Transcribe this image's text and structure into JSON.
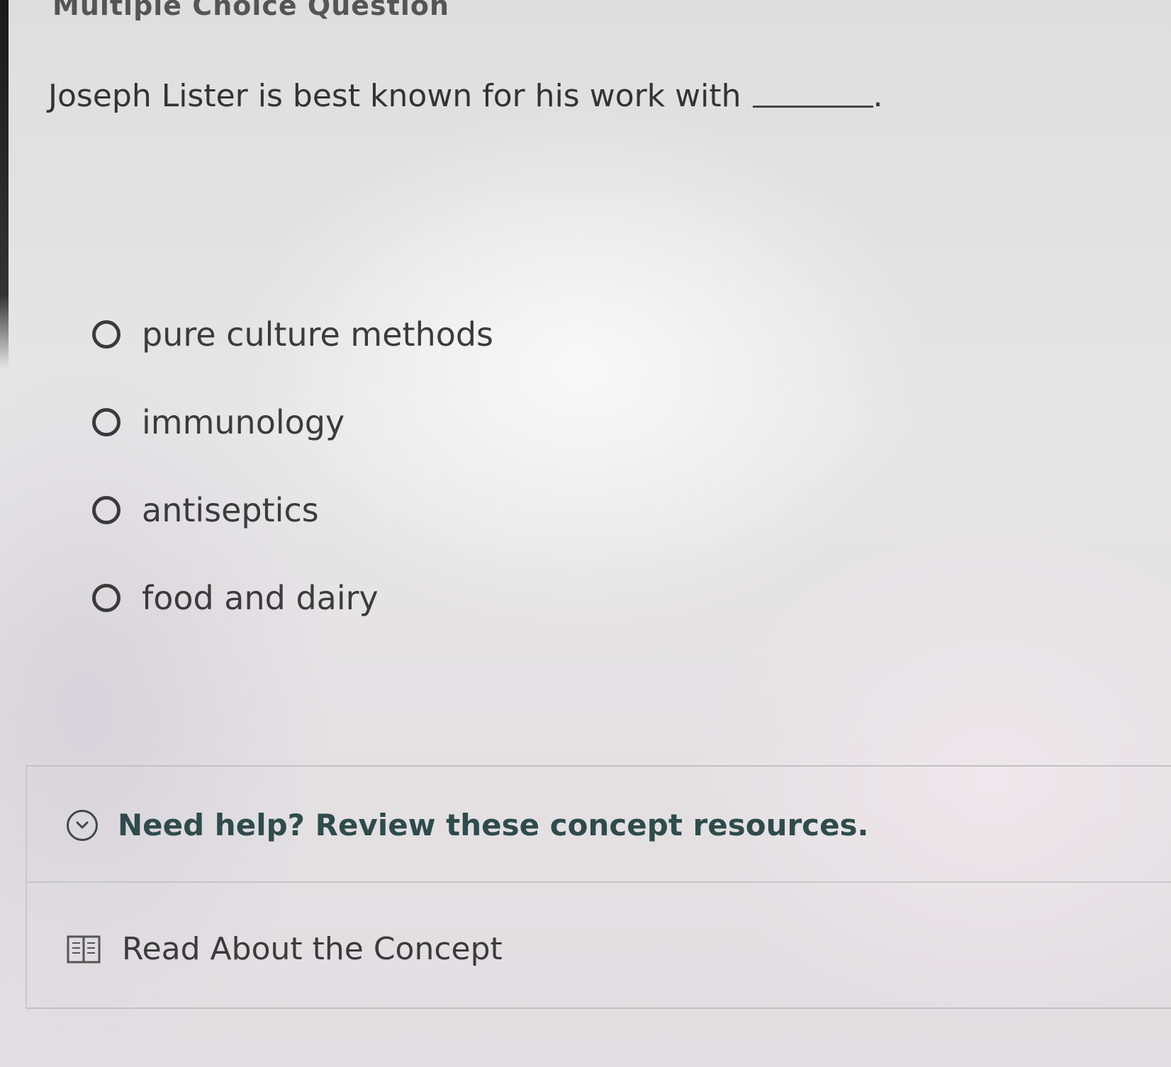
{
  "page_title": "Multiple Choice Question",
  "question": {
    "prompt": "Joseph Lister is best known for his work with",
    "blank_suffix": "."
  },
  "options": [
    {
      "label": "pure culture methods",
      "selected": false
    },
    {
      "label": "immunology",
      "selected": false
    },
    {
      "label": "antiseptics",
      "selected": false
    },
    {
      "label": "food and dairy",
      "selected": false
    }
  ],
  "help": {
    "toggle_label": "Need help? Review these concept resources.",
    "toggle_icon": "chevron-down-circle-icon",
    "resources": [
      {
        "label": "Read About the Concept",
        "icon": "book-icon"
      }
    ]
  },
  "colors": {
    "help_text": "#2f4b4b",
    "body_text": "#3b3b3b"
  }
}
